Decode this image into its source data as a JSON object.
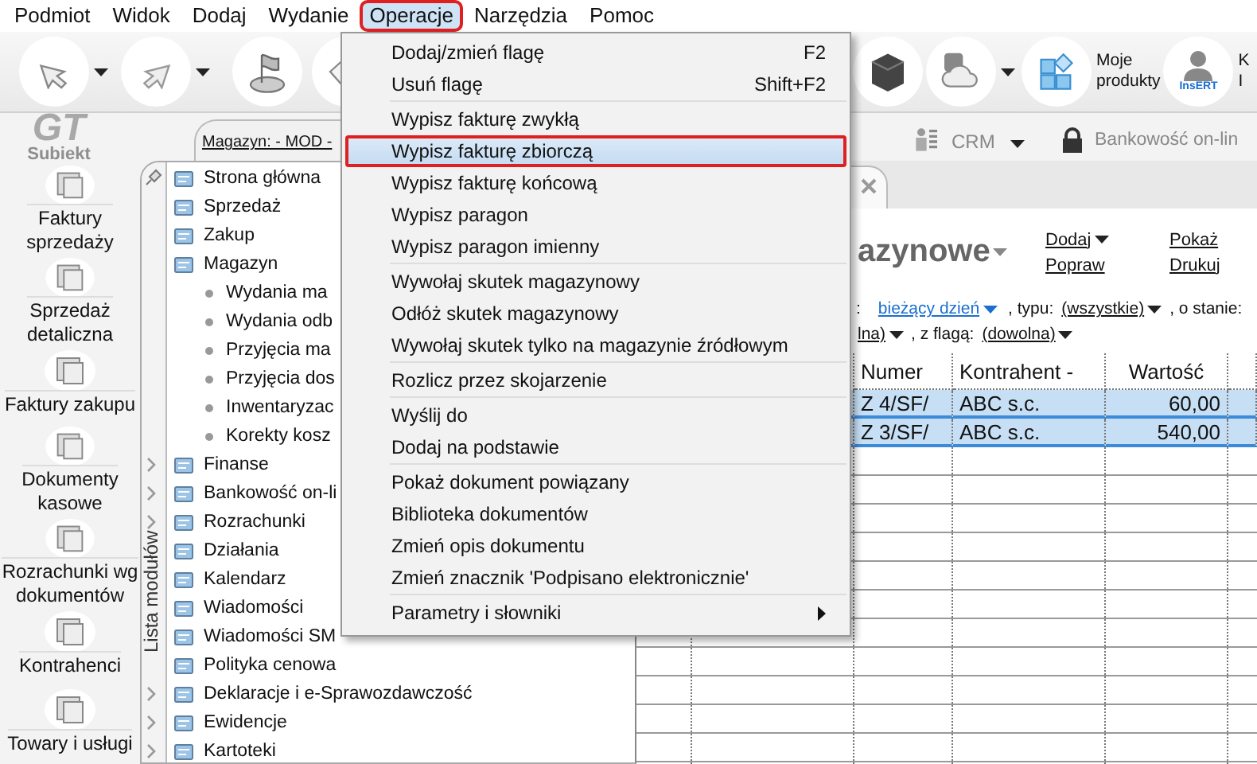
{
  "menubar": [
    {
      "label": "Podmiot",
      "selected": false
    },
    {
      "label": "Widok",
      "selected": false
    },
    {
      "label": "Dodaj",
      "selected": false
    },
    {
      "label": "Wydanie",
      "selected": false
    },
    {
      "label": "Operacje",
      "selected": true
    },
    {
      "label": "Narzędzia",
      "selected": false
    },
    {
      "label": "Pomoc",
      "selected": false
    }
  ],
  "toolbar": {
    "products_label": "Moje\nprodukty",
    "avatar_badge": "InsERT",
    "user_lines": [
      "K",
      "I"
    ]
  },
  "logo": {
    "mark": "GT",
    "name": "Subiekt"
  },
  "shortcuts": [
    {
      "label": "Faktury\nsprzedaży"
    },
    {
      "label": "Sprzedaż\ndetaliczna"
    },
    {
      "label": "Faktury zakupu"
    },
    {
      "label": "Dokumenty\nkasowe"
    },
    {
      "label": "Rozrachunki wg\ndokumentów"
    },
    {
      "label": "Kontrahenci"
    },
    {
      "label": "Towary i usługi"
    }
  ],
  "tabs": {
    "magazyn": "Magazyn: - MOD -",
    "crm": "CRM",
    "bank": "Bankowość on-lin"
  },
  "module_list": {
    "title": "Lista modułów",
    "items": [
      {
        "label": "Strona główna",
        "expandable": false
      },
      {
        "label": "Sprzedaż",
        "expandable": false
      },
      {
        "label": "Zakup",
        "expandable": false
      },
      {
        "label": "Magazyn",
        "expandable": false,
        "children": [
          {
            "label": "Wydania ma"
          },
          {
            "label": "Wydania odb"
          },
          {
            "label": "Przyjęcia ma"
          },
          {
            "label": "Przyjęcia dos"
          },
          {
            "label": "Inwentaryzac"
          },
          {
            "label": "Korekty kosz"
          }
        ]
      },
      {
        "label": "Finanse",
        "expandable": true
      },
      {
        "label": "Bankowość on-li",
        "expandable": true
      },
      {
        "label": "Rozrachunki",
        "expandable": true
      },
      {
        "label": "Działania",
        "expandable": false
      },
      {
        "label": "Kalendarz",
        "expandable": false
      },
      {
        "label": "Wiadomości",
        "expandable": false
      },
      {
        "label": "Wiadomości SM",
        "expandable": false
      },
      {
        "label": "Polityka cenowa",
        "expandable": false
      },
      {
        "label": "Deklaracje i e-Sprawozdawczość",
        "expandable": true
      },
      {
        "label": "Ewidencje",
        "expandable": true
      },
      {
        "label": "Kartoteki",
        "expandable": true
      }
    ]
  },
  "document_view": {
    "title": "azynowe",
    "actions": [
      [
        "Dodaj",
        "Popraw"
      ],
      [
        "Pokaż",
        "Drukuj"
      ]
    ],
    "filters": [
      [
        {
          "kind": "text",
          "text": ":"
        },
        {
          "kind": "link",
          "text": "bieżący dzień"
        },
        {
          "kind": "text",
          "text": ", typu:"
        },
        {
          "kind": "dropdown",
          "text": "(wszystkie)"
        },
        {
          "kind": "text",
          "text": ", o stanie:"
        }
      ],
      [
        {
          "kind": "dropdown",
          "text": "lna)"
        },
        {
          "kind": "text",
          "text": ", z flagą:"
        },
        {
          "kind": "dropdown",
          "text": "(dowolna)"
        }
      ]
    ],
    "table": {
      "columns": [
        "Numer",
        "Kontrahent -",
        "Wartość"
      ],
      "rows": [
        {
          "cells": [
            "Z 4/SF/",
            "ABC s.c.",
            "60,00"
          ],
          "selected": true
        },
        {
          "cells": [
            "Z 3/SF/",
            "ABC s.c.",
            "540,00"
          ],
          "selected": true
        }
      ]
    }
  },
  "dropdown_menu": {
    "groups": [
      [
        {
          "label": "Dodaj/zmień flagę",
          "shortcut": "F2",
          "selected": false
        },
        {
          "label": "Usuń flagę",
          "shortcut": "Shift+F2",
          "selected": false
        }
      ],
      [
        {
          "label": "Wypisz fakturę zwykłą",
          "selected": false
        },
        {
          "label": "Wypisz fakturę zbiorczą",
          "selected": true
        },
        {
          "label": "Wypisz fakturę końcową",
          "selected": false
        },
        {
          "label": "Wypisz paragon",
          "selected": false
        },
        {
          "label": "Wypisz paragon imienny",
          "selected": false
        }
      ],
      [
        {
          "label": "Wywołaj skutek magazynowy",
          "selected": false
        },
        {
          "label": "Odłóż skutek magazynowy",
          "selected": false
        },
        {
          "label": "Wywołaj skutek tylko na magazynie źródłowym",
          "selected": false
        }
      ],
      [
        {
          "label": "Rozlicz przez skojarzenie",
          "selected": false
        }
      ],
      [
        {
          "label": "Wyślij do",
          "selected": false
        },
        {
          "label": "Dodaj na podstawie",
          "selected": false
        }
      ],
      [
        {
          "label": "Pokaż dokument powiązany",
          "selected": false
        },
        {
          "label": "Biblioteka dokumentów",
          "selected": false
        },
        {
          "label": "Zmień opis dokumentu",
          "selected": false
        },
        {
          "label": "Zmień znacznik 'Podpisano elektronicznie'",
          "selected": false
        }
      ],
      [
        {
          "label": "Parametry i słowniki",
          "selected": false,
          "submenu": true
        }
      ]
    ]
  }
}
